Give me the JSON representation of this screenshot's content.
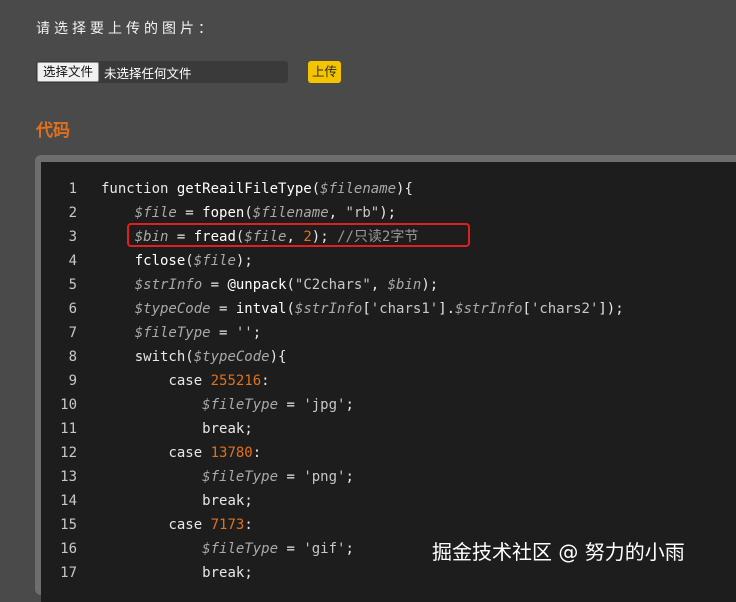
{
  "form": {
    "prompt": "请选择要上传的图片：",
    "choose_file_label": "选择文件",
    "no_file_text": "未选择任何文件",
    "upload_label": "上传"
  },
  "section": {
    "title": "代码"
  },
  "code_lines": [
    {
      "n": "1",
      "code": "function getReailFileType($filename){"
    },
    {
      "n": "2",
      "code": "    $file = fopen($filename, \"rb\");"
    },
    {
      "n": "3",
      "code": "    $bin = fread($file, 2); //只读2字节"
    },
    {
      "n": "4",
      "code": "    fclose($file);"
    },
    {
      "n": "5",
      "code": "    $strInfo = @unpack(\"C2chars\", $bin);"
    },
    {
      "n": "6",
      "code": "    $typeCode = intval($strInfo['chars1'].$strInfo['chars2']);"
    },
    {
      "n": "7",
      "code": "    $fileType = '';"
    },
    {
      "n": "8",
      "code": "    switch($typeCode){"
    },
    {
      "n": "9",
      "code": "        case 255216:"
    },
    {
      "n": "10",
      "code": "            $fileType = 'jpg';"
    },
    {
      "n": "11",
      "code": "            break;"
    },
    {
      "n": "12",
      "code": "        case 13780:"
    },
    {
      "n": "13",
      "code": "            $fileType = 'png';"
    },
    {
      "n": "14",
      "code": "            break;"
    },
    {
      "n": "15",
      "code": "        case 7173:"
    },
    {
      "n": "16",
      "code": "            $fileType = 'gif';"
    },
    {
      "n": "17",
      "code": "            break;"
    }
  ],
  "watermark": "掘金技术社区 @ 努力的小雨",
  "colors": {
    "accent": "#e0701e",
    "upload_button": "#f5c400",
    "highlight_box": "#e02020"
  }
}
